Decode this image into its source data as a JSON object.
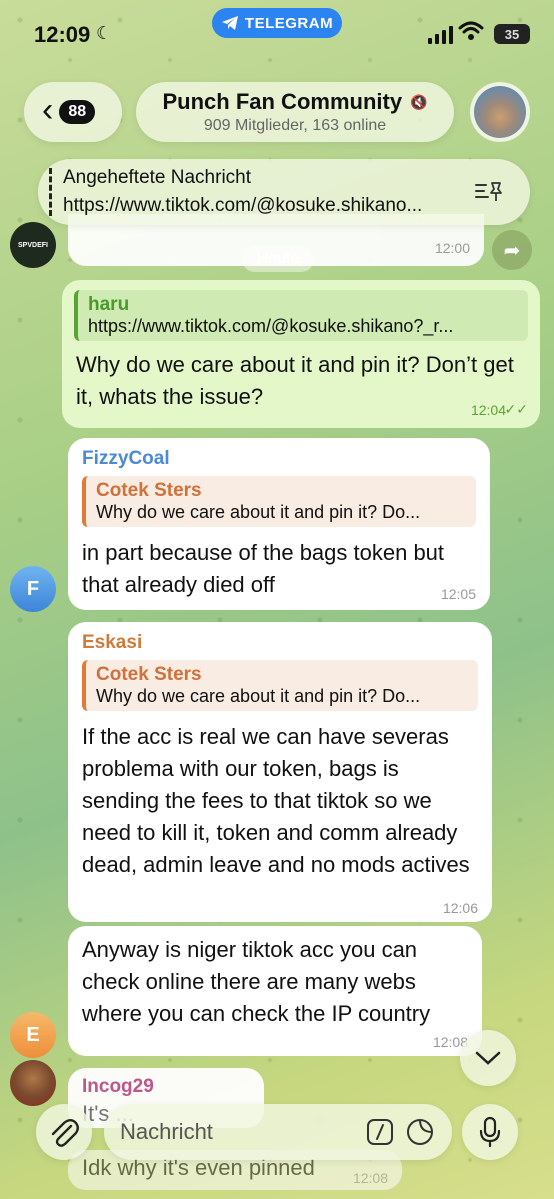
{
  "status_bar": {
    "time": "12:09",
    "telegram_label": "TELEGRAM",
    "battery": "35"
  },
  "header": {
    "back_badge": "88",
    "title": "Punch Fan Community",
    "subtitle": "909 Mitglieder, 163 online"
  },
  "pinned": {
    "title": "Angeheftete Nachricht",
    "text": "https://www.tiktok.com/@kosuke.shikano..."
  },
  "partial_message": {
    "time": "12:00",
    "avatar_label": "SPVDEFI"
  },
  "day_separator": "Heute",
  "messages": [
    {
      "reply_name": "haru",
      "reply_text": "https://www.tiktok.com/@kosuke.shikano?_r...",
      "text": "Why do we care about it and pin it? Don’t get it, whats the issue?",
      "time": "12:04",
      "status": "✓✓"
    },
    {
      "sender": "FizzyCoal",
      "reply_name": "Cotek Sters",
      "reply_text": "Why do we care about it and pin it? Do...",
      "text": "in part  because of the bags token but that already died off",
      "time": "12:05",
      "avatar_letter": "F"
    },
    {
      "sender": "Eskasi",
      "reply_name": "Cotek Sters",
      "reply_text": "Why do we care about it and pin it? Do...",
      "text": "If the acc is real we can have severas problema with our token, bags is sending the fees to that tiktok so we need to kill it, token and comm already dead, admin leave and no mods actives",
      "time": "12:06"
    },
    {
      "text": "Anyway is niger tiktok acc you can check online there are many webs where you can check the IP country",
      "time": "12:08",
      "avatar_letter": "E"
    },
    {
      "sender": "Incog29",
      "text": "It's ...",
      "text2": "Idk why it's even pinned",
      "time": "12:08"
    }
  ],
  "composer": {
    "placeholder": "Nachricht"
  },
  "colors": {
    "fizzycoal": "#4a8bd4",
    "eskasi": "#d07a3a",
    "incog29": "#c0508a",
    "reply_out": "#5aa335",
    "reply_orange": "#e07a38"
  }
}
